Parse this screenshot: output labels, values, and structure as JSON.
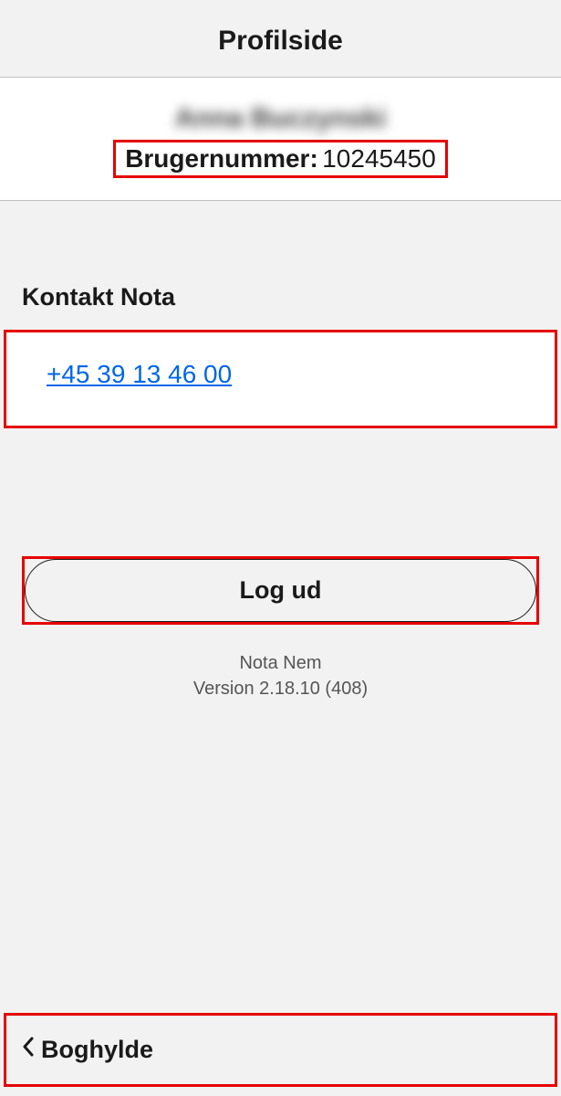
{
  "header": {
    "title": "Profilside"
  },
  "profile": {
    "name": "Anna Buczynski",
    "usernum_label": "Brugernummer:",
    "usernum_value": "10245450"
  },
  "contact": {
    "heading": "Kontakt Nota",
    "phone": "+45 39 13 46 00"
  },
  "logout": {
    "label": "Log ud"
  },
  "appinfo": {
    "name": "Nota Nem",
    "version": "Version 2.18.10 (408)"
  },
  "footer": {
    "back_label": "Boghylde"
  },
  "highlight_color": "#e60000",
  "link_color": "#0066e6"
}
